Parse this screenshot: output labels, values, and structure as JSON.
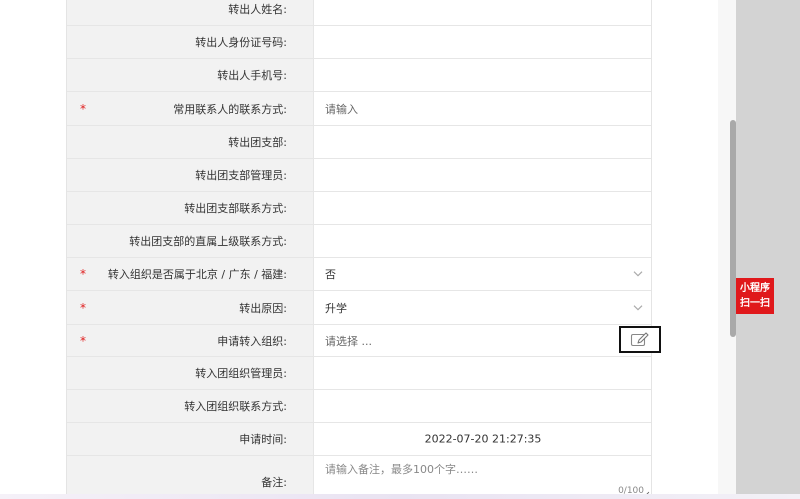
{
  "form": {
    "rows": [
      {
        "label": "转出人姓名:",
        "required": false,
        "value": ""
      },
      {
        "label": "转出人身份证号码:",
        "required": false,
        "value": ""
      },
      {
        "label": "转出人手机号:",
        "required": false,
        "value": ""
      },
      {
        "label": "常用联系人的联系方式:",
        "required": true,
        "placeholder": "请输入"
      },
      {
        "label": "转出团支部:",
        "required": false,
        "value": ""
      },
      {
        "label": "转出团支部管理员:",
        "required": false,
        "value": ""
      },
      {
        "label": "转出团支部联系方式:",
        "required": false,
        "value": ""
      },
      {
        "label": "转出团支部的直属上级联系方式:",
        "required": false,
        "value": ""
      },
      {
        "label": "转入组织是否属于北京 / 广东 / 福建:",
        "required": true,
        "value": "否"
      },
      {
        "label": "转出原因:",
        "required": true,
        "value": "升学"
      },
      {
        "label": "申请转入组织:",
        "required": true,
        "placeholder": "请选择 ..."
      },
      {
        "label": "转入团组织管理员:",
        "required": false,
        "value": ""
      },
      {
        "label": "转入团组织联系方式:",
        "required": false,
        "value": ""
      },
      {
        "label": "申请时间:",
        "required": false,
        "value": "2022-07-20 21:27:35"
      },
      {
        "label": "备注:",
        "required": false,
        "placeholder": "请输入备注，最多100个字……",
        "counter": "0/100"
      }
    ],
    "required_mark": "*"
  },
  "side": {
    "miniprogram_line1": "小程序",
    "miniprogram_line2": "扫一扫"
  },
  "icons": {
    "edit": "pencil-edit-icon",
    "dropdown": "chevron-down-icon",
    "resize": "resize-grip-icon"
  },
  "colors": {
    "required": "#e02020",
    "miniprogram_bg": "#e0181b",
    "label_bg": "#f2f2f2"
  }
}
